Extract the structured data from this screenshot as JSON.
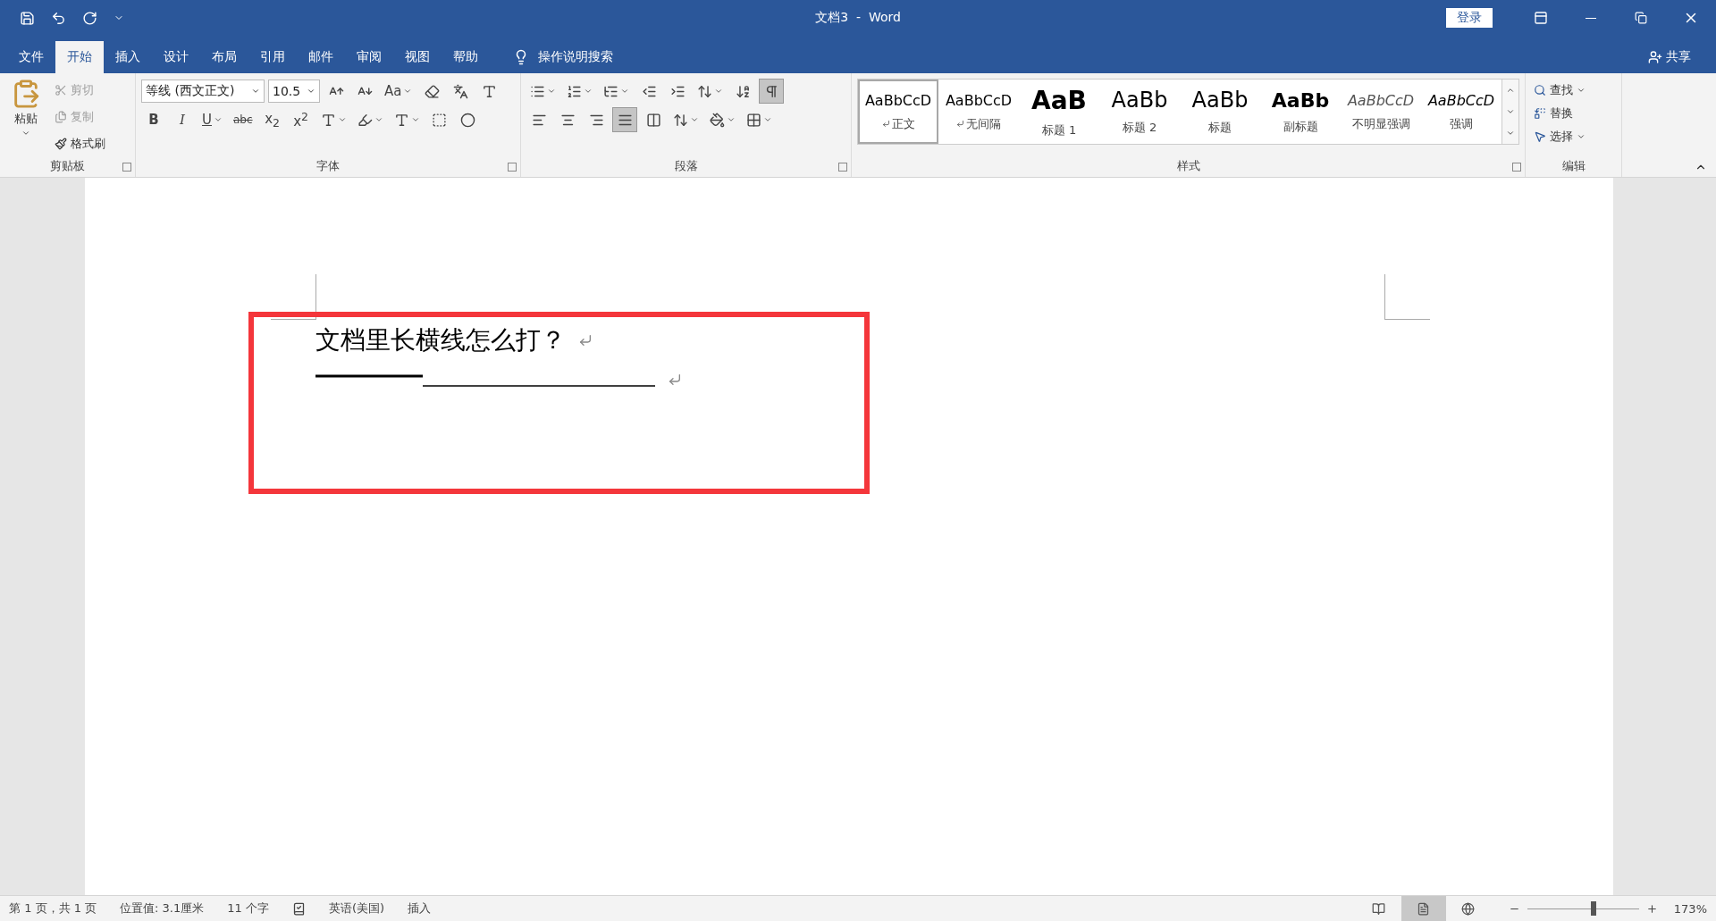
{
  "window": {
    "title": "文档3  -  Word",
    "login": "登录"
  },
  "tabs": [
    {
      "label": "文件",
      "selected": false
    },
    {
      "label": "开始",
      "selected": true
    },
    {
      "label": "插入",
      "selected": false
    },
    {
      "label": "设计",
      "selected": false
    },
    {
      "label": "布局",
      "selected": false
    },
    {
      "label": "引用",
      "selected": false
    },
    {
      "label": "邮件",
      "selected": false
    },
    {
      "label": "审阅",
      "selected": false
    },
    {
      "label": "视图",
      "selected": false
    },
    {
      "label": "帮助",
      "selected": false
    }
  ],
  "tell_me": {
    "label": "操作说明搜索"
  },
  "share": {
    "label": "共享"
  },
  "clipboard": {
    "title": "剪贴板",
    "paste": "粘贴",
    "actions": [
      {
        "kind": "cut",
        "label": "剪切",
        "disabled": true
      },
      {
        "kind": "copy",
        "label": "复制",
        "disabled": true
      },
      {
        "kind": "painter",
        "label": "格式刷",
        "disabled": false
      }
    ]
  },
  "font": {
    "title": "字体",
    "font_name": "等线 (西文正文)",
    "font_size": "10.5",
    "change_case": "Aa",
    "formats": [
      {
        "kind": "bold",
        "label": "B"
      },
      {
        "kind": "italic",
        "label": "I"
      },
      {
        "kind": "underline",
        "label": "U"
      },
      {
        "kind": "strike",
        "label": "abc"
      },
      {
        "kind": "sub",
        "label": "x$_{2}$"
      },
      {
        "kind": "sup",
        "label": "x$^{2}$"
      }
    ]
  },
  "paragraph": {
    "title": "段落",
    "alignments": [
      {
        "kind": "left",
        "selected": false
      },
      {
        "kind": "center",
        "selected": false
      },
      {
        "kind": "right",
        "selected": false
      },
      {
        "kind": "justify",
        "selected": true
      },
      {
        "kind": "distributed",
        "selected": false
      }
    ],
    "show_marks": true
  },
  "styles": {
    "title": "样式",
    "items": [
      {
        "kind": "normal",
        "preview": "AaBbCcD",
        "label": "正文",
        "mark": true,
        "selected": true
      },
      {
        "kind": "normal",
        "preview": "AaBbCcD",
        "label": "无间隔",
        "mark": true,
        "selected": false
      },
      {
        "kind": "heading1",
        "preview": "AaB",
        "label": "标题 1",
        "mark": false,
        "selected": false
      },
      {
        "kind": "heading2",
        "preview": "AaBb",
        "label": "标题 2",
        "mark": false,
        "selected": false
      },
      {
        "kind": "title",
        "preview": "AaBb",
        "label": "标题",
        "mark": false,
        "selected": false
      },
      {
        "kind": "subtitle",
        "preview": "AaBb",
        "label": "副标题",
        "mark": false,
        "selected": false
      },
      {
        "kind": "subtle",
        "preview": "AaBbCcD",
        "label": "不明显强调",
        "mark": false,
        "selected": false
      },
      {
        "kind": "emphasis",
        "preview": "AaBbCcD",
        "label": "强调",
        "mark": false,
        "selected": false
      }
    ]
  },
  "editing": {
    "title": "编辑",
    "actions": [
      {
        "kind": "find",
        "label": "查找",
        "caret": true
      },
      {
        "kind": "replace",
        "label": "替换",
        "caret": false
      },
      {
        "kind": "select",
        "label": "选择",
        "caret": true
      }
    ]
  },
  "document": {
    "paragraphs": [
      {
        "kind": "text",
        "text": "文档里长横线怎么打？"
      },
      {
        "kind": "rule"
      }
    ]
  },
  "status_bar": {
    "items": [
      {
        "kind": "text",
        "text": "第 1 页，共 1 页"
      },
      {
        "kind": "text",
        "text": "位置值: 3.1厘米"
      },
      {
        "kind": "text",
        "text": "11 个字"
      },
      {
        "kind": "proofing"
      },
      {
        "kind": "text",
        "text": "英语(美国)"
      },
      {
        "kind": "text",
        "text": "插入"
      }
    ],
    "views": [
      {
        "kind": "read",
        "selected": false
      },
      {
        "kind": "print",
        "selected": true
      },
      {
        "kind": "web",
        "selected": false
      }
    ],
    "zoom": {
      "level": 0.59,
      "reading": "173%"
    }
  }
}
